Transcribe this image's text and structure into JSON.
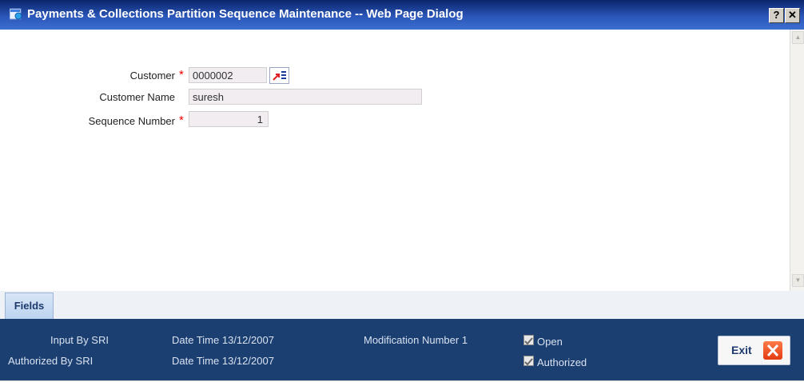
{
  "window": {
    "title": "Payments & Collections Partition Sequence Maintenance -- Web Page Dialog",
    "help_label": "?",
    "close_label": "✕"
  },
  "form": {
    "customer_label": "Customer",
    "customer_value": "0000002",
    "customer_name_label": "Customer Name",
    "customer_name_value": "suresh",
    "sequence_label": "Sequence Number",
    "sequence_value": "1",
    "required_mark": "*"
  },
  "tabs": [
    {
      "label": "Fields"
    }
  ],
  "audit": {
    "input_by": "Input By SRI",
    "authorized_by": "Authorized By SRI",
    "date_time_1": "Date Time 13/12/2007",
    "date_time_2": "Date Time 13/12/2007",
    "modification": "Modification Number 1",
    "open_label": "Open",
    "open_checked": true,
    "authorized_label": "Authorized",
    "authorized_checked": true
  },
  "exit_label": "Exit",
  "colors": {
    "titlebar": "#0a246a",
    "footer": "#1c3f72",
    "required": "#e60000",
    "exit_icon": "#e23b10"
  }
}
